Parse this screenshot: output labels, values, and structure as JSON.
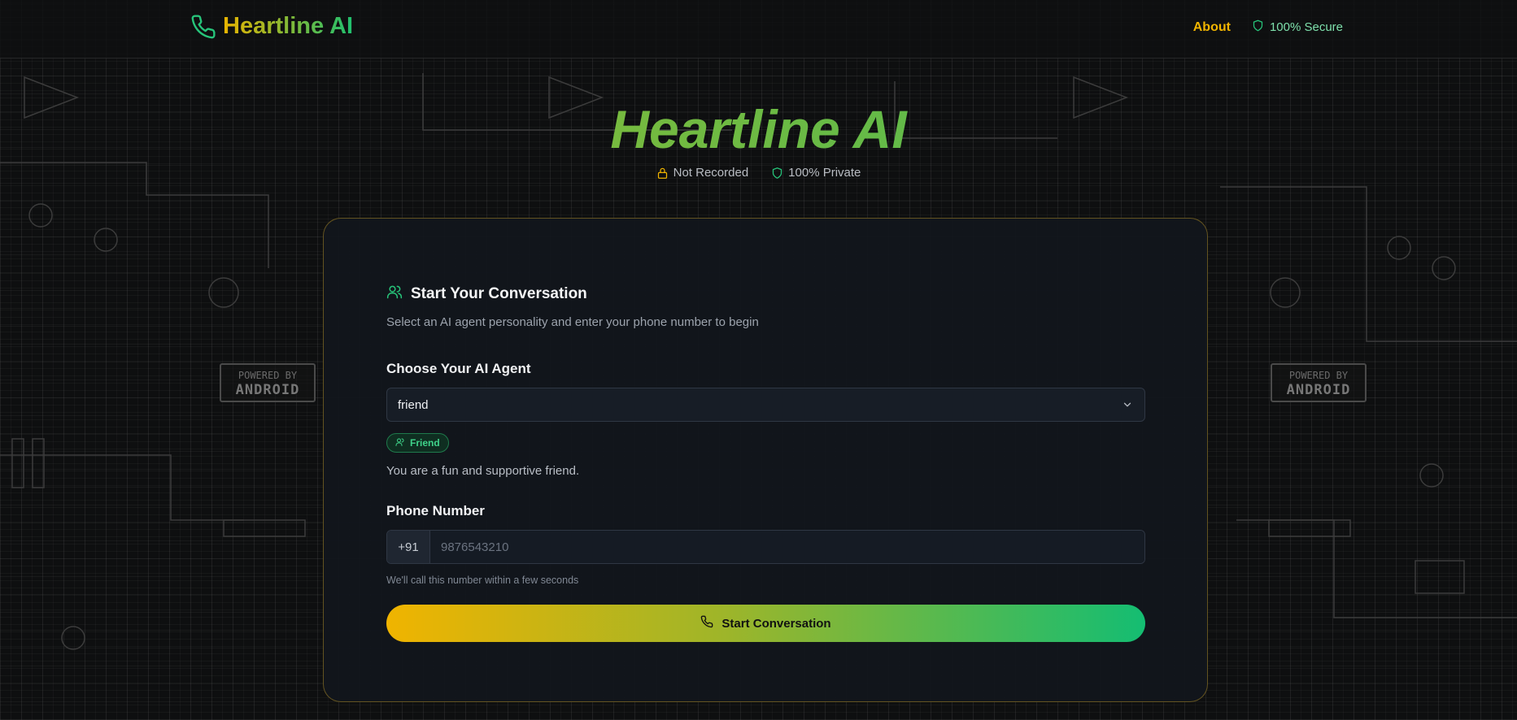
{
  "header": {
    "brand_name": "Heartline AI",
    "brand_icon": "phone-icon",
    "nav_about": "About",
    "nav_secure": "100% Secure",
    "secure_icon": "shield-icon"
  },
  "hero": {
    "title": "Heartline AI",
    "badges": [
      {
        "icon": "lock-icon",
        "label": "Not Recorded"
      },
      {
        "icon": "shield-icon",
        "label": "100% Private"
      }
    ]
  },
  "card": {
    "title": "Start Your Conversation",
    "title_icon": "users-icon",
    "subtitle": "Select an AI agent personality and enter your phone number to begin",
    "agent_label": "Choose Your AI Agent",
    "agent_selected": "friend",
    "agent_badge": "Friend",
    "agent_description": "You are a fun and supportive friend.",
    "phone_label": "Phone Number",
    "country_code": "+91",
    "phone_placeholder": "9876543210",
    "phone_value": "",
    "phone_hint": "We'll call this number within a few seconds",
    "cta_label": "Start Conversation"
  },
  "background": {
    "chip_line1": "POWERED BY",
    "chip_line2": "ANDROID"
  },
  "colors": {
    "accent_yellow": "#f0b400",
    "accent_green": "#14bd72",
    "card_bg": "#11151c",
    "card_border": "#c9a028"
  }
}
